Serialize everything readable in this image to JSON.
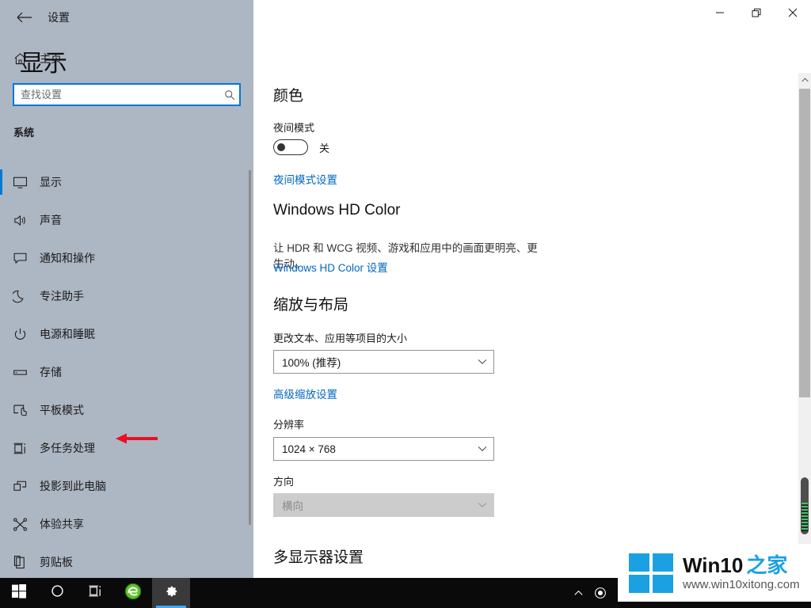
{
  "window": {
    "title": "设置",
    "back_icon": "back-arrow-icon",
    "minimize_label": "—",
    "restore_label": "❐",
    "close_label": "✕"
  },
  "sidebar": {
    "home": {
      "label": "主页",
      "icon": "home-icon"
    },
    "search": {
      "placeholder": "查找设置",
      "value": "",
      "icon": "search-icon"
    },
    "group_label": "系统",
    "accent_color": "#0078d7",
    "background_color": "#adb6c3",
    "items": [
      {
        "label": "显示",
        "icon": "monitor-icon",
        "selected": true
      },
      {
        "label": "声音",
        "icon": "speaker-icon",
        "selected": false
      },
      {
        "label": "通知和操作",
        "icon": "notification-icon",
        "selected": false
      },
      {
        "label": "专注助手",
        "icon": "moon-icon",
        "selected": false
      },
      {
        "label": "电源和睡眠",
        "icon": "power-icon",
        "selected": false
      },
      {
        "label": "存储",
        "icon": "drive-icon",
        "selected": false
      },
      {
        "label": "平板模式",
        "icon": "tablet-mode-icon",
        "selected": false
      },
      {
        "label": "多任务处理",
        "icon": "multitasking-icon",
        "selected": false
      },
      {
        "label": "投影到此电脑",
        "icon": "project-icon",
        "selected": false
      },
      {
        "label": "体验共享",
        "icon": "shared-experience-icon",
        "selected": false
      },
      {
        "label": "剪贴板",
        "icon": "clipboard-icon",
        "selected": false
      }
    ],
    "annotation": {
      "type": "red-left-arrow",
      "color": "#e81123",
      "points_at": "多任务处理"
    }
  },
  "main": {
    "page_title": "显示",
    "sections": {
      "color": {
        "heading": "颜色",
        "night_light_label": "夜间模式",
        "night_light_state": "关",
        "night_light_on": false,
        "night_light_link": "夜间模式设置"
      },
      "hd_color": {
        "heading": "Windows HD Color",
        "description": "让 HDR 和 WCG 视频、游戏和应用中的画面更明亮、更生动。",
        "link": "Windows HD Color 设置"
      },
      "scale_layout": {
        "heading": "缩放与布局",
        "scale_label": "更改文本、应用等项目的大小",
        "scale_value": "100% (推荐)",
        "scale_link": "高级缩放设置",
        "resolution_label": "分辨率",
        "resolution_value": "1024 × 768",
        "orientation_label": "方向",
        "orientation_value": "横向",
        "orientation_disabled": true
      },
      "multi_display": {
        "heading": "多显示器设置"
      }
    },
    "link_color": "#0067c0"
  },
  "scrollbar": {
    "up_icon": "chevron-up-icon",
    "thumb_name": "scroll-thumb"
  },
  "taskbar": {
    "background_color": "#0a0a0a",
    "buttons": [
      {
        "name": "start-button",
        "icon": "windows-logo-icon",
        "active": false
      },
      {
        "name": "cortana-button",
        "icon": "circle-icon",
        "active": false
      },
      {
        "name": "task-view-button",
        "icon": "task-view-icon",
        "active": false
      },
      {
        "name": "browser-button",
        "icon": "green-browser-icon",
        "active": false
      },
      {
        "name": "settings-button",
        "icon": "gear-icon",
        "active": true
      }
    ],
    "tray": [
      {
        "name": "show-hidden-icons",
        "icon": "chevron-up-icon"
      },
      {
        "name": "recording-indicator",
        "icon": "record-circle-icon"
      }
    ]
  },
  "watermark": {
    "brand_en": "Win10",
    "brand_cn": "之家",
    "url": "www.win10xitong.com",
    "logo_color": "#1ba1e2"
  }
}
